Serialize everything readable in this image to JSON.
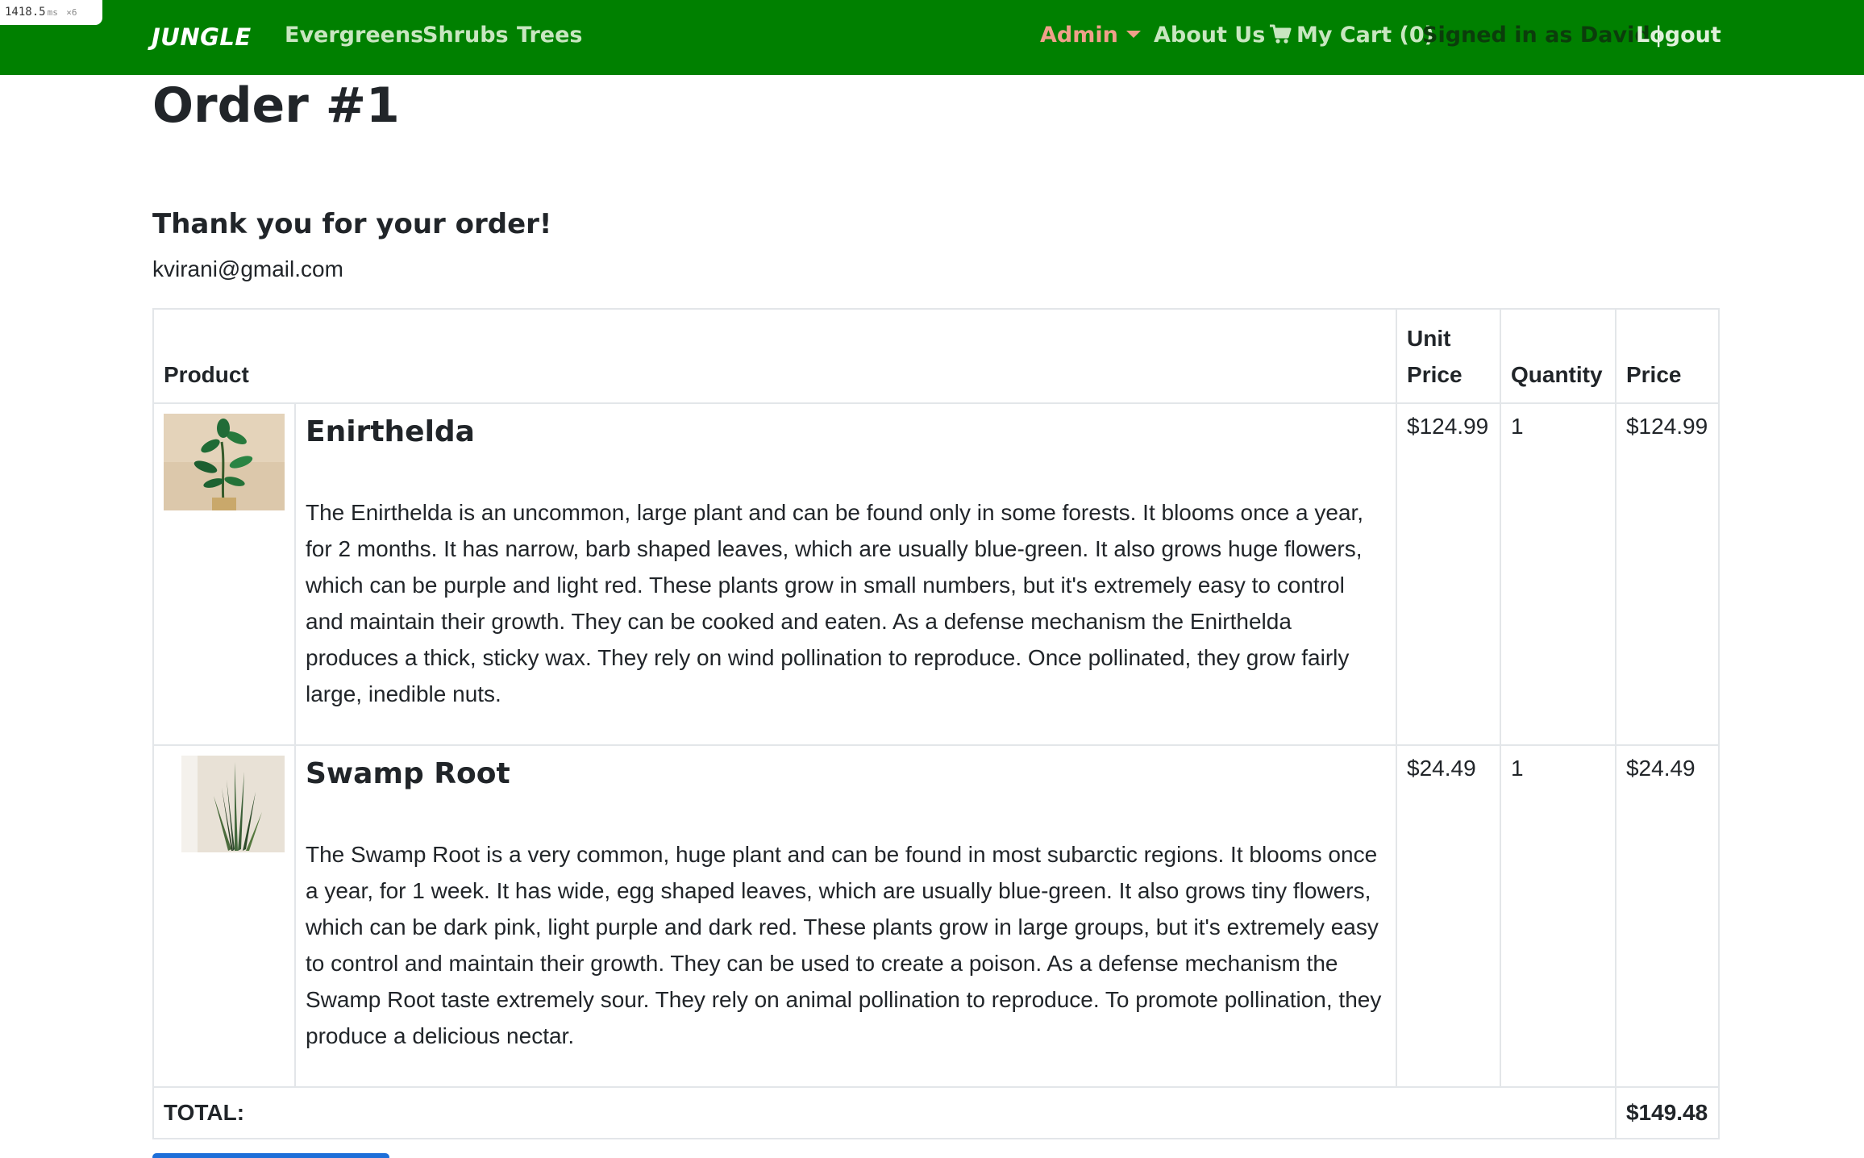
{
  "perf": {
    "value": "1418.5",
    "unit": "ms",
    "multiplier": "×6"
  },
  "nav": {
    "brand": "JUNGLE",
    "links": [
      "Evergreens",
      "Shrubs",
      "Trees"
    ],
    "admin": "Admin",
    "about": "About Us",
    "cart": "My Cart (0)",
    "signed_in": "Signed in as David",
    "separator": "|",
    "logout": "Logout",
    "colors": {
      "bar": "#008000",
      "admin": "#f0a08a"
    }
  },
  "order": {
    "title": "Order #1",
    "thanks": "Thank you for your order!",
    "email": "kvirani@gmail.com",
    "headers": {
      "product": "Product",
      "unit_price": "Unit Price",
      "quantity": "Quantity",
      "price": "Price"
    },
    "items": [
      {
        "name": "Enirthelda",
        "image": "potted-plant-icon",
        "description": "The Enirthelda is an uncommon, large plant and can be found only in some forests. It blooms once a year, for 2 months. It has narrow, barb shaped leaves, which are usually blue-green. It also grows huge flowers, which can be purple and light red. These plants grow in small numbers, but it's extremely easy to control and maintain their growth. They can be cooked and eaten. As a defense mechanism the Enirthelda produces a thick, sticky wax. They rely on wind pollination to reproduce. Once pollinated, they grow fairly large, inedible nuts.",
        "unit_price": "$124.99",
        "quantity": "1",
        "price": "$124.99"
      },
      {
        "name": "Swamp Root",
        "image": "snake-plant-icon",
        "description": "The Swamp Root is a very common, huge plant and can be found in most subarctic regions. It blooms once a year, for 1 week. It has wide, egg shaped leaves, which are usually blue-green. It also grows tiny flowers, which can be dark pink, light purple and dark red. These plants grow in large groups, but it's extremely easy to control and maintain their growth. They can be used to create a poison. As a defense mechanism the Swamp Root taste extremely sour. They rely on animal pollination to reproduce. To promote pollination, they produce a delicious nectar.",
        "unit_price": "$24.49",
        "quantity": "1",
        "price": "$24.49"
      }
    ],
    "total_label": "TOTAL:",
    "total": "$149.48"
  }
}
